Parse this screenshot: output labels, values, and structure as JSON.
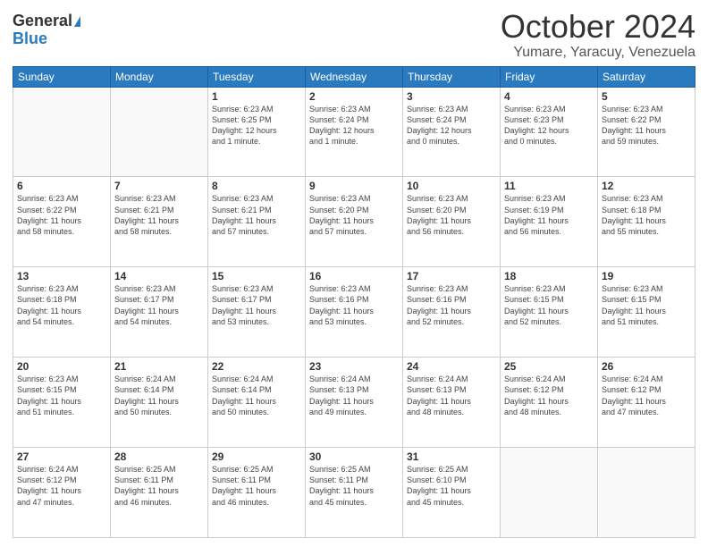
{
  "header": {
    "logo_line1": "General",
    "logo_line2": "Blue",
    "month": "October 2024",
    "location": "Yumare, Yaracuy, Venezuela"
  },
  "days_of_week": [
    "Sunday",
    "Monday",
    "Tuesday",
    "Wednesday",
    "Thursday",
    "Friday",
    "Saturday"
  ],
  "weeks": [
    [
      {
        "day": "",
        "content": ""
      },
      {
        "day": "",
        "content": ""
      },
      {
        "day": "1",
        "content": "Sunrise: 6:23 AM\nSunset: 6:25 PM\nDaylight: 12 hours\nand 1 minute."
      },
      {
        "day": "2",
        "content": "Sunrise: 6:23 AM\nSunset: 6:24 PM\nDaylight: 12 hours\nand 1 minute."
      },
      {
        "day": "3",
        "content": "Sunrise: 6:23 AM\nSunset: 6:24 PM\nDaylight: 12 hours\nand 0 minutes."
      },
      {
        "day": "4",
        "content": "Sunrise: 6:23 AM\nSunset: 6:23 PM\nDaylight: 12 hours\nand 0 minutes."
      },
      {
        "day": "5",
        "content": "Sunrise: 6:23 AM\nSunset: 6:22 PM\nDaylight: 11 hours\nand 59 minutes."
      }
    ],
    [
      {
        "day": "6",
        "content": "Sunrise: 6:23 AM\nSunset: 6:22 PM\nDaylight: 11 hours\nand 58 minutes."
      },
      {
        "day": "7",
        "content": "Sunrise: 6:23 AM\nSunset: 6:21 PM\nDaylight: 11 hours\nand 58 minutes."
      },
      {
        "day": "8",
        "content": "Sunrise: 6:23 AM\nSunset: 6:21 PM\nDaylight: 11 hours\nand 57 minutes."
      },
      {
        "day": "9",
        "content": "Sunrise: 6:23 AM\nSunset: 6:20 PM\nDaylight: 11 hours\nand 57 minutes."
      },
      {
        "day": "10",
        "content": "Sunrise: 6:23 AM\nSunset: 6:20 PM\nDaylight: 11 hours\nand 56 minutes."
      },
      {
        "day": "11",
        "content": "Sunrise: 6:23 AM\nSunset: 6:19 PM\nDaylight: 11 hours\nand 56 minutes."
      },
      {
        "day": "12",
        "content": "Sunrise: 6:23 AM\nSunset: 6:18 PM\nDaylight: 11 hours\nand 55 minutes."
      }
    ],
    [
      {
        "day": "13",
        "content": "Sunrise: 6:23 AM\nSunset: 6:18 PM\nDaylight: 11 hours\nand 54 minutes."
      },
      {
        "day": "14",
        "content": "Sunrise: 6:23 AM\nSunset: 6:17 PM\nDaylight: 11 hours\nand 54 minutes."
      },
      {
        "day": "15",
        "content": "Sunrise: 6:23 AM\nSunset: 6:17 PM\nDaylight: 11 hours\nand 53 minutes."
      },
      {
        "day": "16",
        "content": "Sunrise: 6:23 AM\nSunset: 6:16 PM\nDaylight: 11 hours\nand 53 minutes."
      },
      {
        "day": "17",
        "content": "Sunrise: 6:23 AM\nSunset: 6:16 PM\nDaylight: 11 hours\nand 52 minutes."
      },
      {
        "day": "18",
        "content": "Sunrise: 6:23 AM\nSunset: 6:15 PM\nDaylight: 11 hours\nand 52 minutes."
      },
      {
        "day": "19",
        "content": "Sunrise: 6:23 AM\nSunset: 6:15 PM\nDaylight: 11 hours\nand 51 minutes."
      }
    ],
    [
      {
        "day": "20",
        "content": "Sunrise: 6:23 AM\nSunset: 6:15 PM\nDaylight: 11 hours\nand 51 minutes."
      },
      {
        "day": "21",
        "content": "Sunrise: 6:24 AM\nSunset: 6:14 PM\nDaylight: 11 hours\nand 50 minutes."
      },
      {
        "day": "22",
        "content": "Sunrise: 6:24 AM\nSunset: 6:14 PM\nDaylight: 11 hours\nand 50 minutes."
      },
      {
        "day": "23",
        "content": "Sunrise: 6:24 AM\nSunset: 6:13 PM\nDaylight: 11 hours\nand 49 minutes."
      },
      {
        "day": "24",
        "content": "Sunrise: 6:24 AM\nSunset: 6:13 PM\nDaylight: 11 hours\nand 48 minutes."
      },
      {
        "day": "25",
        "content": "Sunrise: 6:24 AM\nSunset: 6:12 PM\nDaylight: 11 hours\nand 48 minutes."
      },
      {
        "day": "26",
        "content": "Sunrise: 6:24 AM\nSunset: 6:12 PM\nDaylight: 11 hours\nand 47 minutes."
      }
    ],
    [
      {
        "day": "27",
        "content": "Sunrise: 6:24 AM\nSunset: 6:12 PM\nDaylight: 11 hours\nand 47 minutes."
      },
      {
        "day": "28",
        "content": "Sunrise: 6:25 AM\nSunset: 6:11 PM\nDaylight: 11 hours\nand 46 minutes."
      },
      {
        "day": "29",
        "content": "Sunrise: 6:25 AM\nSunset: 6:11 PM\nDaylight: 11 hours\nand 46 minutes."
      },
      {
        "day": "30",
        "content": "Sunrise: 6:25 AM\nSunset: 6:11 PM\nDaylight: 11 hours\nand 45 minutes."
      },
      {
        "day": "31",
        "content": "Sunrise: 6:25 AM\nSunset: 6:10 PM\nDaylight: 11 hours\nand 45 minutes."
      },
      {
        "day": "",
        "content": ""
      },
      {
        "day": "",
        "content": ""
      }
    ]
  ]
}
